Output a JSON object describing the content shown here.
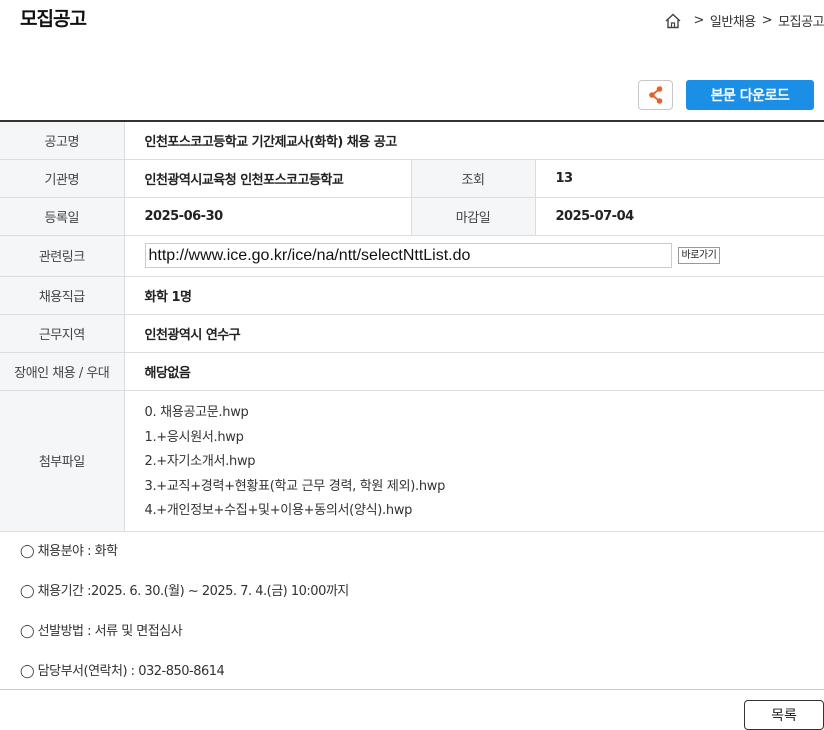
{
  "header": {
    "title": "모집공고",
    "breadcrumb": [
      "일반채용",
      "모집공고"
    ],
    "separator": ">"
  },
  "actions": {
    "download_label": "본문 다운로드",
    "list_label": "목록",
    "go_label": "바로가기"
  },
  "colors": {
    "accent": "#1b8ee5",
    "share_icon": "#e5622b",
    "header_cell_bg": "#f4f6f8"
  },
  "posting": {
    "title_label": "공고명",
    "title": "인천포스코고등학교 기간제교사(화학) 채용 공고",
    "agency_label": "기관명",
    "agency": "인천광역시교육청 인천포스코고등학교",
    "views_label": "조회",
    "views": "13",
    "registered_label": "등록일",
    "registered": "2025-06-30",
    "deadline_label": "마감일",
    "deadline": "2025-07-04",
    "link_label": "관련링크",
    "link": "http://www.ice.go.kr/ice/na/ntt/selectNttList.do",
    "position_label": "채용직급",
    "position": "화학 1명",
    "location_label": "근무지역",
    "location": "인천광역시 연수구",
    "disability_label": "장애인 채용 / 우대",
    "disability": "해당없음",
    "attachments_label": "첨부파일",
    "attachments": [
      "0. 채용공고문.hwp",
      "1.+응시원서.hwp",
      "2.+자기소개서.hwp",
      "3.+교직+경력+현황표(학교 근무 경력, 학원 제외).hwp",
      "4.+개인정보+수집+및+이용+동의서(양식).hwp"
    ]
  },
  "notes": [
    "◯ 채용분야 : 화학",
    "◯ 채용기간 :2025. 6. 30.(월) ~ 2025. 7. 4.(금) 10:00까지",
    "◯ 선발방법 : 서류 및 면접심사",
    "◯ 담당부서(연락처) : 032-850-8614"
  ],
  "icons": {
    "home": "home-icon",
    "share": "share-icon"
  }
}
